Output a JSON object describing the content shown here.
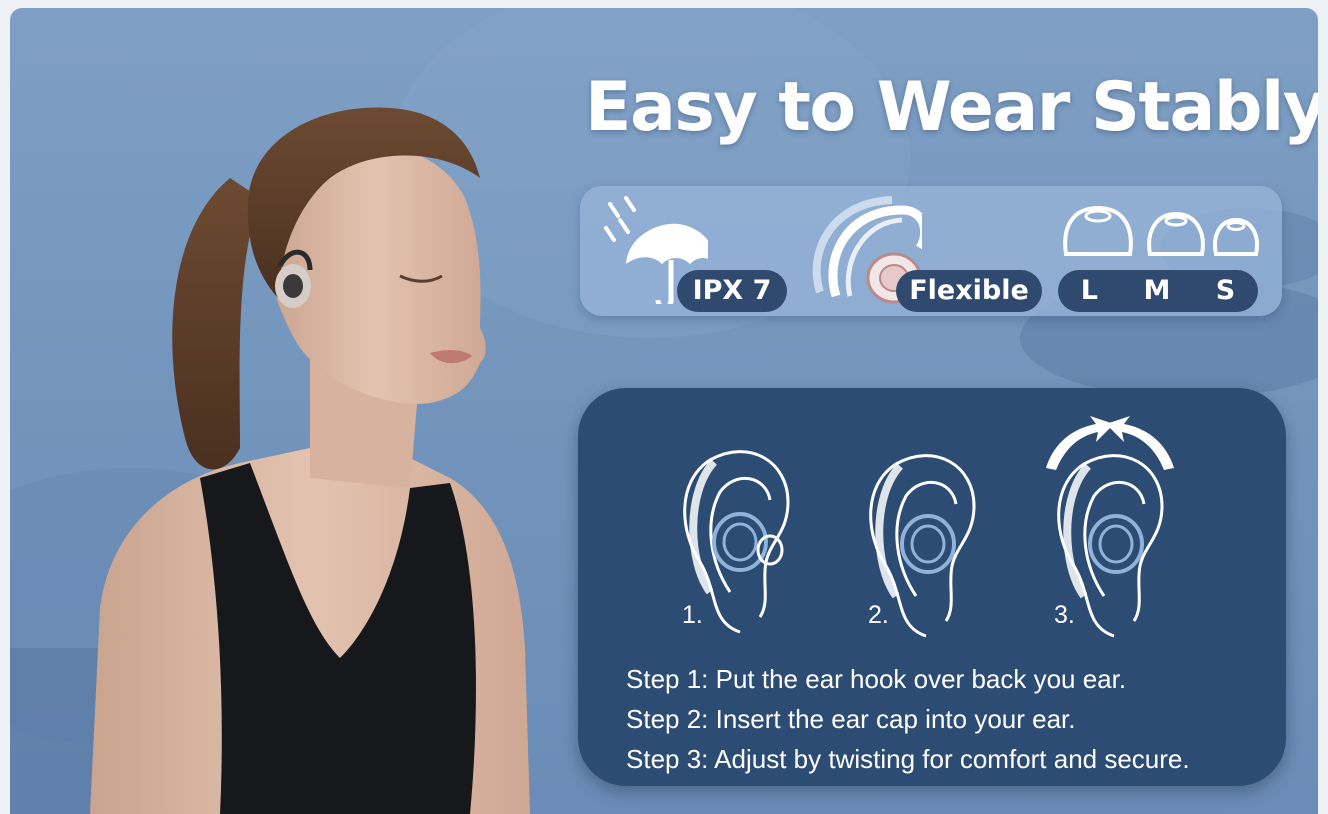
{
  "title": "Easy to Wear Stably",
  "features": {
    "waterproof_label": "IPX 7",
    "flexible_label": "Flexible",
    "sizes": [
      "L",
      "M",
      "S"
    ]
  },
  "steps": {
    "numbers": [
      "1.",
      "2.",
      "3."
    ],
    "instructions": [
      "Step 1: Put the ear hook over back you ear.",
      "Step 2: Insert the ear cap into your ear.",
      "Step 3: Adjust by twisting for comfort and secure."
    ]
  },
  "colors": {
    "background": "#7597be",
    "panel": "#2d4c74",
    "pill": "#2f4a6e",
    "text": "#ffffff"
  }
}
